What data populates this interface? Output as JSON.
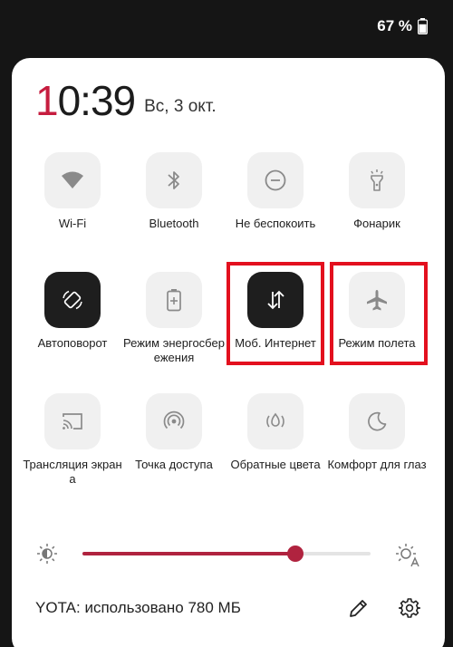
{
  "status": {
    "battery_percent_label": "67 %",
    "battery_level": 0.67
  },
  "header": {
    "time": "10:39",
    "time_first_digit": "1",
    "time_rest": "0:39",
    "date": "Вс, 3 окт."
  },
  "tiles": [
    {
      "label": "Wi-Fi",
      "icon": "wifi-icon",
      "active": false
    },
    {
      "label": "Bluetooth",
      "icon": "bluetooth-icon",
      "active": false
    },
    {
      "label": "Не беспокоить",
      "icon": "do-not-disturb-icon",
      "active": false
    },
    {
      "label": "Фонарик",
      "icon": "flashlight-icon",
      "active": false
    },
    {
      "label": "Автоповорот",
      "icon": "auto-rotate-icon",
      "active": true
    },
    {
      "label": "Режим энергосбережения",
      "icon": "battery-saver-icon",
      "active": false
    },
    {
      "label": "Моб. Интернет",
      "icon": "mobile-data-icon",
      "active": true
    },
    {
      "label": "Режим полета",
      "icon": "airplane-icon",
      "active": false
    },
    {
      "label": "Трансляция экрана",
      "icon": "cast-icon",
      "active": false
    },
    {
      "label": "Точка доступа",
      "icon": "hotspot-icon",
      "active": false
    },
    {
      "label": "Обратные цвета",
      "icon": "invert-colors-icon",
      "active": false
    },
    {
      "label": "Комфорт для глаз",
      "icon": "eye-comfort-icon",
      "active": false
    }
  ],
  "brightness": {
    "level": 0.74,
    "low_icon": "brightness-low-icon",
    "auto_icon": "brightness-auto-icon"
  },
  "footer": {
    "data_usage": "YOTA: использовано 780 МБ",
    "edit_icon": "pencil-icon",
    "settings_icon": "gear-icon"
  },
  "colors": {
    "accent": "#b0233f",
    "highlight": "#e3101e",
    "active_tile": "#1e1e1e",
    "inactive_tile": "#f0f0f0"
  }
}
